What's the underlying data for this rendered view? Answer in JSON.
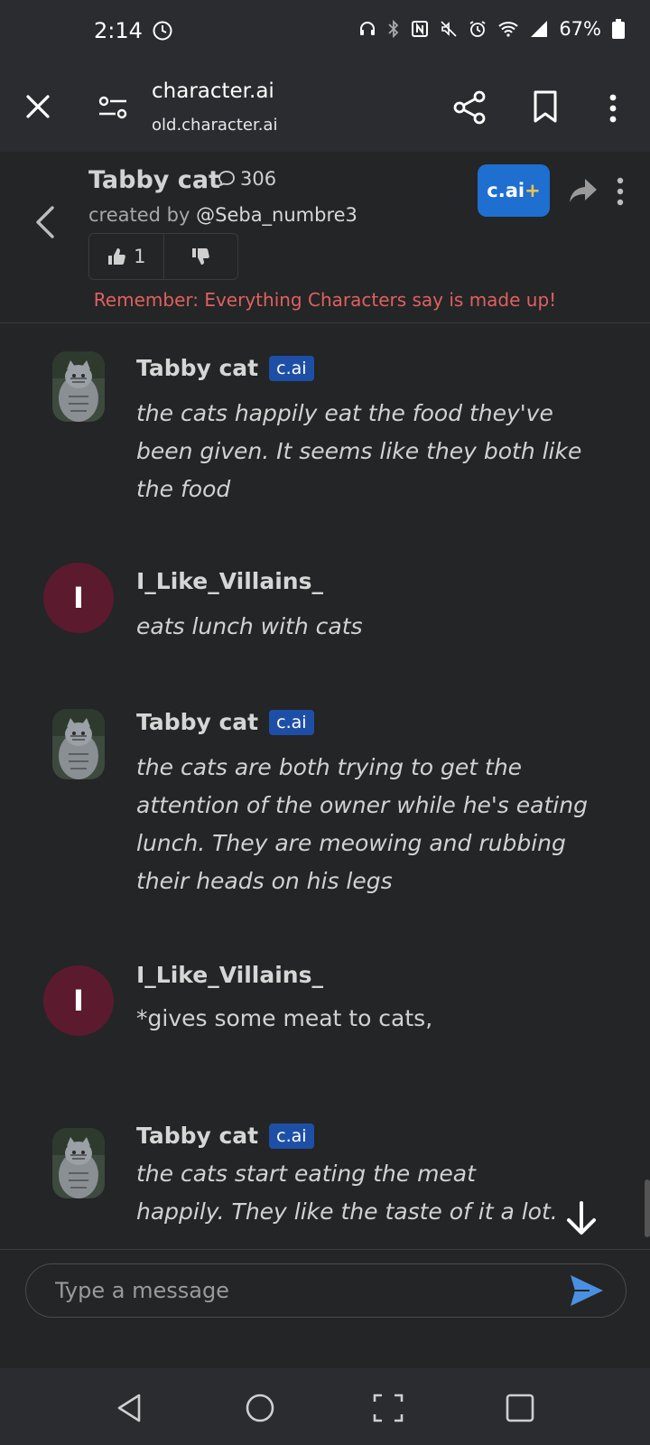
{
  "status_bar": {
    "time": "2:14",
    "battery": "67%"
  },
  "browser": {
    "site_title": "character.ai",
    "url": "old.character.ai"
  },
  "character": {
    "name": "Tabby cat",
    "chat_count": "306",
    "created_by_prefix": "created by ",
    "creator": "@Seba_numbre3",
    "likes": "1",
    "plus_label": "c.ai",
    "plus_suffix": "+",
    "disclaimer": "Remember: Everything Characters say is made up!"
  },
  "messages": [
    {
      "sender": "Tabby cat",
      "badge": "c.ai",
      "kind": "character",
      "text": "the cats happily eat the food they've been given. It seems like they both like the food"
    },
    {
      "sender": "I_Like_Villains_",
      "avatar_letter": "I",
      "kind": "user",
      "text": "eats lunch with cats"
    },
    {
      "sender": "Tabby cat",
      "badge": "c.ai",
      "kind": "character",
      "text": "the cats are both trying to get the attention of the owner while he's eating lunch. They are meowing and rubbing their heads on his legs"
    },
    {
      "sender": "I_Like_Villains_",
      "avatar_letter": "I",
      "kind": "user",
      "text": "*gives some meat to cats,"
    },
    {
      "sender": "Tabby cat",
      "badge": "c.ai",
      "kind": "character",
      "text": "the cats start eating the meat happily. They like the taste of it a lot."
    }
  ],
  "input": {
    "placeholder": "Type a message"
  },
  "colors": {
    "accent_blue": "#1e6fd0",
    "badge_blue": "#1e4fa6",
    "user_avatar": "#5c1a2e",
    "disclaimer_red": "#e06060",
    "send_icon": "#4a90e2"
  },
  "icons": {
    "close": "close-icon",
    "tune": "tune-icon",
    "share": "share-icon",
    "bookmark": "bookmark-icon",
    "more": "more-vert-icon",
    "back": "chevron-left-icon",
    "chat": "chat-bubble-icon",
    "thumb_up": "thumb-up-icon",
    "thumb_down": "thumb-down-icon",
    "forward": "forward-icon",
    "scroll_down": "arrow-down-icon",
    "send": "send-icon"
  }
}
